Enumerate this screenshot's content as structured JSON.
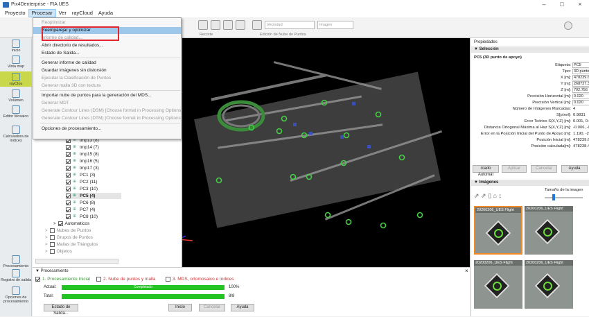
{
  "window": {
    "title": "Pix4Denterprise - FIA UES",
    "min": "–",
    "max": "□",
    "close": "×"
  },
  "menubar": [
    "Proyecto",
    "Procesar",
    "Ver",
    "rayCloud",
    "Ayuda"
  ],
  "toolbar": {
    "label_1": "Recorte",
    "label_2": "Edición de Nube de Puntos",
    "select_1": "Vecindad",
    "select_2": "Imagen"
  },
  "processing_menu": {
    "items": [
      {
        "label": "Reoptimizar",
        "disabled": true
      },
      {
        "label": "Reemparejar y optimizar",
        "disabled": false
      },
      {
        "label": "Informe de calidad...",
        "disabled": true
      },
      {
        "label": "Abrir directorio de resultados...",
        "disabled": false
      },
      {
        "label": "Estado de Salida...",
        "disabled": false
      },
      {
        "label": "Generar informe de calidad",
        "disabled": false
      },
      {
        "label": "Guardar imágenes sin distorsión",
        "disabled": false
      },
      {
        "label": "Ejecutar la Clasificación de Puntos",
        "disabled": true
      },
      {
        "label": "Generar malla 3D con textura",
        "disabled": true
      },
      {
        "label": "Importar nube de puntos para la generación del MDS...",
        "disabled": false
      },
      {
        "label": "Generar MDT",
        "disabled": true
      },
      {
        "label": "Generate Contour Lines (DSM) [Choose format in Processing Options]",
        "disabled": true
      },
      {
        "label": "Generate Contour Lines (DTM) [Choose format in Processing Options]",
        "disabled": true
      },
      {
        "label": "Opciones de procesamiento...",
        "disabled": false
      }
    ]
  },
  "left_sidebar": {
    "items": [
      "Inicio",
      "Vista map",
      "rayClou",
      "Volúmen",
      "Editor Mosaico",
      "Calculadora de índices",
      "Procesamiento",
      "Registro de salida",
      "Opciones de procesamiento"
    ]
  },
  "layer_tree": {
    "rows": [
      "tmp13 (8)",
      "tmp14 (7)",
      "tmp15 (8)",
      "tmp16 (5)",
      "tmp17 (3)",
      "PC1 (3)",
      "PC2 (11)",
      "PC3 (10)",
      "PC5 (4)",
      "PC6 (8)",
      "PC7 (4)",
      "PC8 (10)"
    ],
    "groups": [
      "Automaticos",
      "Nubes de Puntos",
      "Grupos de Puntos",
      "Mallas de Triángulos",
      "Objetos"
    ]
  },
  "properties": {
    "header": "Propiedades",
    "section": "Selección",
    "subtitle": "PC5 (3D punto de apoyo)",
    "fields": [
      {
        "k": "Etiqueta:",
        "v": "PC5"
      },
      {
        "k": "Tipo:",
        "v": "3D punto ..."
      },
      {
        "k": "X [m]:",
        "v": "478239.63"
      },
      {
        "k": "Y [m]:",
        "v": "268727.39"
      },
      {
        "k": "Z [m]:",
        "v": "702.756"
      },
      {
        "k": "Precisión Horizontal [m]:",
        "v": "0.020"
      },
      {
        "k": "Precisión Vertical [m]:",
        "v": "0.020"
      },
      {
        "k": "Número de Imágenes Marcadas:",
        "v": "4"
      },
      {
        "k": "S[píxel]:",
        "v": "0.9831"
      },
      {
        "k": "Error Teórico S(X,Y,Z) [m]:",
        "v": "0.001, 0.00"
      },
      {
        "k": "Distancia Ortogonal Máxima al Haz S(X,Y,Z) [m]:",
        "v": "-0.006, -0.0"
      },
      {
        "k": "Error en la Posición Inicial del Punto de Apoyo [m]:",
        "v": "1.190, -2.6"
      },
      {
        "k": "Posición Inicial [m]:",
        "v": "478239.620"
      },
      {
        "k": "Posición calculada[m]:",
        "v": "478238.430"
      }
    ],
    "buttons": [
      "rcado Automát",
      "Aplicar",
      "Cancelar",
      "Ayuda"
    ]
  },
  "images": {
    "section": "Imágenes",
    "thumb_size_label": "Tamaño de la imagen",
    "captions": [
      "20200206_UES Flight",
      "20200206_UES Flight",
      "20200206_UES Flight",
      "20200206_UES Flight"
    ]
  },
  "processing": {
    "header": "Procesamiento",
    "steps": [
      "1. Procesamiento Inicial",
      "2. Nube de puntos y malla",
      "3. MDS, ortomosaico e índices"
    ],
    "actual_label": "Actual:",
    "actual_bar": "Completado",
    "actual_pct": "100%",
    "actual_progress": 1.0,
    "total_label": "Total:",
    "total_count": "8/8",
    "total_progress": 1.0,
    "buttons": [
      "Estado de Salida...",
      "Inicio",
      "Cancelar",
      "Ayuda"
    ]
  },
  "colors": {
    "accent": "#2d6db5",
    "highlight": "#9dc8ec",
    "progress": "#22c322",
    "annotation": "#e2262b"
  }
}
